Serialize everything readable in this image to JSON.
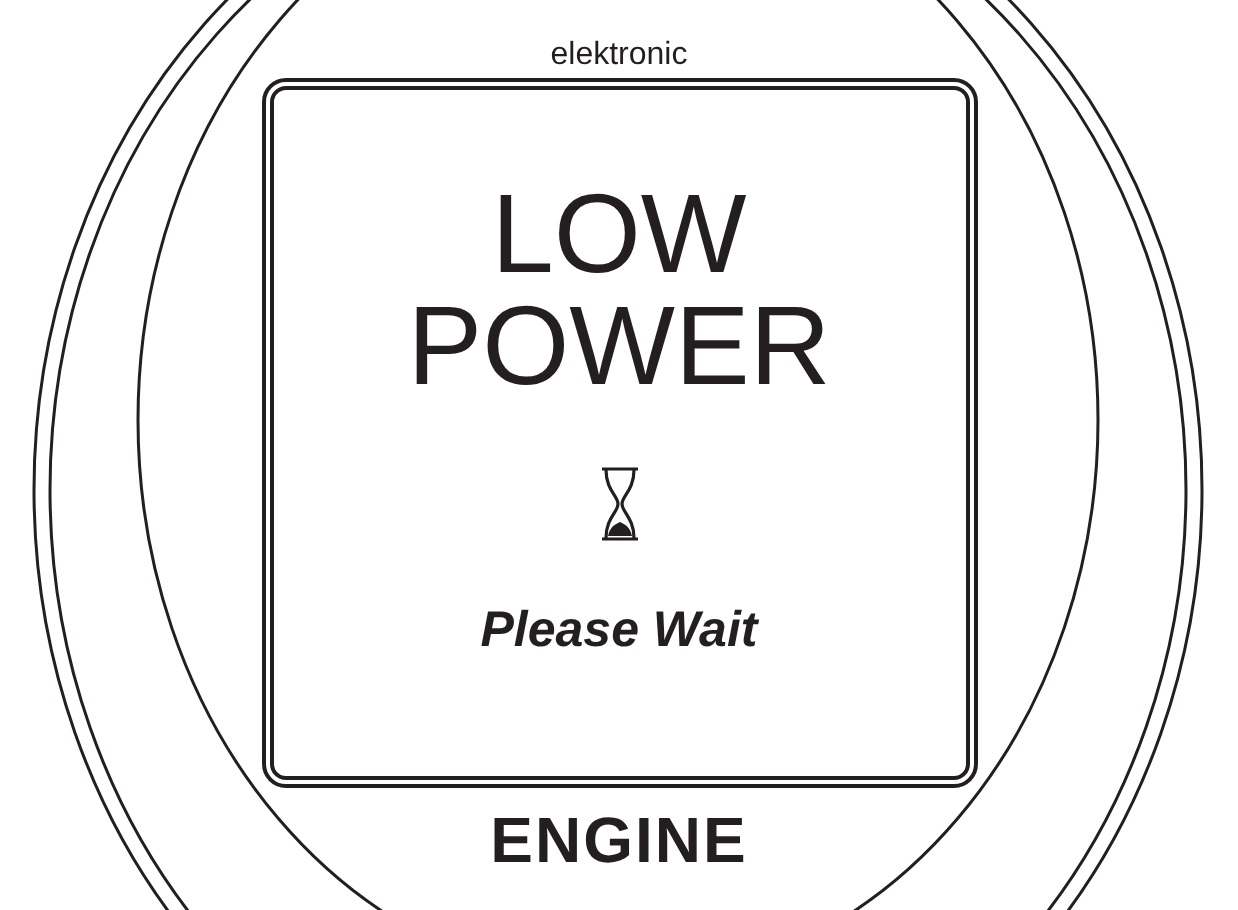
{
  "brand": "elektronic",
  "display": {
    "message_lines": [
      "LOW",
      "POWER"
    ],
    "status": "Please Wait"
  },
  "gauge_label": "ENGINE"
}
